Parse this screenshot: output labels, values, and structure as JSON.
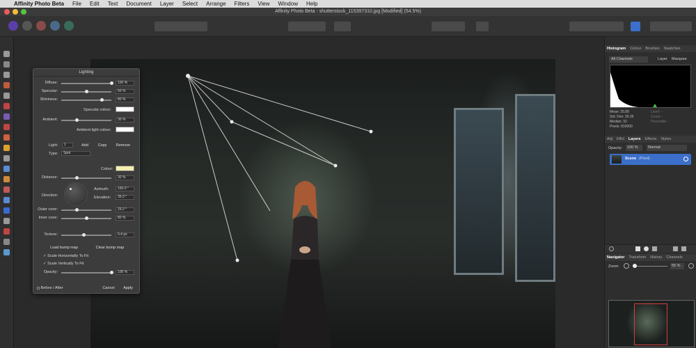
{
  "menubar": {
    "app": "Affinity Photo Beta",
    "items": [
      "File",
      "Edit",
      "Text",
      "Document",
      "Layer",
      "Select",
      "Arrange",
      "Filters",
      "View",
      "Window",
      "Help"
    ]
  },
  "window": {
    "title": "Affinity Photo Beta - shutterstock_115397310.jpg [Modified] (54.5%)"
  },
  "lighting": {
    "title": "Lighting",
    "diffuse": {
      "label": "Diffuse:",
      "value": "100 %",
      "level": 1.0
    },
    "specular": {
      "label": "Specular:",
      "value": "50 %",
      "level": 0.5
    },
    "shininess": {
      "label": "Shininess:",
      "value": "80 %",
      "level": 0.8
    },
    "specular_colour_label": "Specular colour:",
    "specular_colour": "#ffffff",
    "ambient": {
      "label": "Ambient:",
      "value": "30 %",
      "level": 0.3
    },
    "ambient_colour_label": "Ambient light colour:",
    "ambient_colour": "#ffffff",
    "light_label": "Light:",
    "light_value": "1",
    "add": "Add",
    "copy": "Copy",
    "remove": "Remove",
    "type_label": "Type:",
    "type_value": "Spot",
    "colour_label": "Colour:",
    "light_colour": "#f5efb0",
    "distance": {
      "label": "Distance:",
      "value": "30 %",
      "level": 0.3
    },
    "direction_label": "Direction:",
    "azimuth": {
      "label": "Azimuth:",
      "value": "150.0 °"
    },
    "elevation": {
      "label": "Elevation:",
      "value": "35.0 °"
    },
    "outer_cone": {
      "label": "Outer cone:",
      "value": "29.2 °",
      "level": 0.3
    },
    "inner_cone": {
      "label": "Inner cone:",
      "value": "80 %",
      "level": 0.5
    },
    "texture": {
      "label": "Texture:",
      "value": "0.4 px",
      "level": 0.45
    },
    "load_bump": "Load bump map",
    "clear_bump": "Clear bump map",
    "scale_h": "Scale Horizontally To Fit",
    "scale_v": "Scale Vertically To Fit",
    "opacity": {
      "label": "Opacity:",
      "value": "100 %",
      "level": 1.0
    },
    "before_after": "Before / After",
    "cancel": "Cancel",
    "apply": "Apply"
  },
  "right_panel": {
    "tabs1": [
      "Histogram",
      "Colour",
      "Brushes",
      "Swatches"
    ],
    "channels": "All Channels",
    "layer_btn": "Layer",
    "marquee_btn": "Marquee",
    "stats_left": [
      "Mean: 25.89",
      "Std. Dev: 26.36",
      "Median: 32",
      "Pixels: 819000"
    ],
    "stats_right": [
      "Level: -",
      "Count: -",
      "Percentile: -"
    ],
    "tabs2": [
      "Adj",
      "Effct",
      "Layers",
      "Effects",
      "Styles"
    ],
    "opacity_label": "Opacity:",
    "opacity_value": "100 %",
    "blend_mode": "Normal",
    "layer_name": "Scene",
    "layer_type": "(Pixel)",
    "tabs3": [
      "Navigator",
      "Transform",
      "History",
      "Channels"
    ],
    "zoom_label": "Zoom:",
    "zoom_value": "55 %"
  },
  "colors": {
    "accent": "#3b6fc9",
    "bg": "#2b2b2b"
  }
}
